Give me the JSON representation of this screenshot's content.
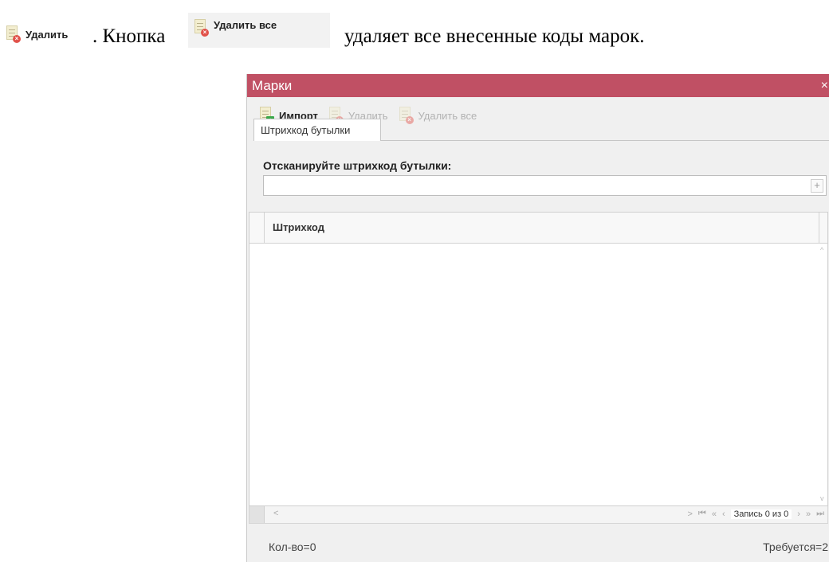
{
  "doc": {
    "btn_delete_label": "Удалить",
    "text_mid": ". Кнопка",
    "btn_delete_all_label": "Удалить все",
    "text_end": "удаляет все внесенные коды марок."
  },
  "window": {
    "title": "Марки",
    "close_glyph": "×",
    "toolbar": {
      "import_label": "Импорт",
      "delete_label": "Удалить",
      "delete_all_label": "Удалить все"
    },
    "tab_label": "Штрихкод бутылки",
    "scan_label": "Отсканируйте штрихкод бутылки:",
    "scan_value": "",
    "plus_glyph": "+",
    "grid": {
      "columns": [
        "Штрихкод"
      ],
      "rows": []
    },
    "pager": {
      "left_glyph": "<",
      "right_glyph": ">",
      "first_glyph": "⏮",
      "prev_page_glyph": "«",
      "prev_glyph": "‹",
      "record_text": "Запись 0 из 0",
      "next_glyph": "›",
      "next_page_glyph": "»",
      "last_glyph": "⏭"
    },
    "footer": {
      "count": "Кол-во=0",
      "required": "Требуется=2"
    }
  },
  "icons": {
    "delete": "document-delete-icon",
    "import": "document-import-icon",
    "close": "close-icon"
  },
  "colors": {
    "titlebar": "#c05064",
    "delete_badge": "#e1524a",
    "import_badge": "#3aa84a"
  }
}
